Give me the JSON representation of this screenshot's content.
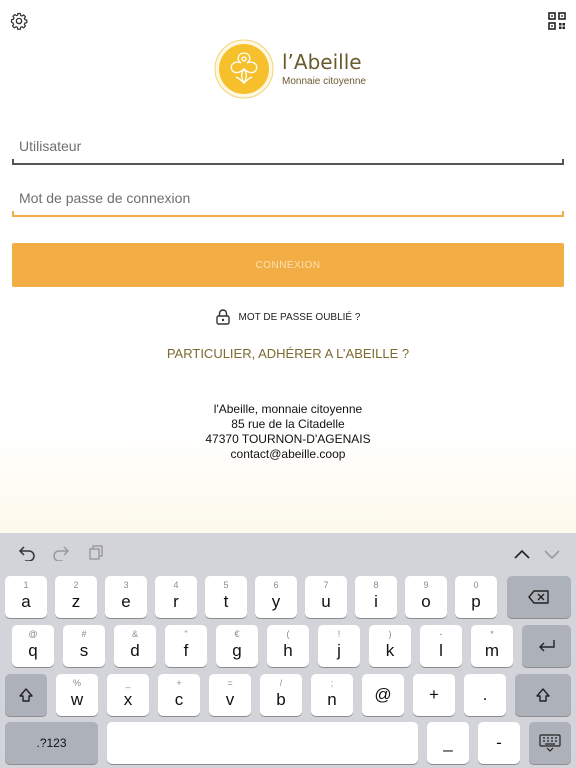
{
  "app": {
    "logo": {
      "title": "l’Abeille",
      "subtitle": "Monnaie citoyenne"
    },
    "icons": {
      "settings": "gear-icon",
      "scan": "qr-code-icon",
      "lock": "lock-icon"
    },
    "username": {
      "placeholder": "Utilisateur",
      "value": ""
    },
    "password": {
      "placeholder": "Mot de passe de connexion",
      "value": ""
    },
    "connect_label": "CONNEXION",
    "forgot_label": "MOT DE PASSE OUBLIÉ ?",
    "join_label": "PARTICULIER, ADHÉRER A L’ABEILLE ?",
    "address": {
      "line1": "l'Abeille, monnaie citoyenne",
      "line2": "85 rue de la Citadelle",
      "line3": "47370 TOURNON-D'AGENAIS",
      "email": "contact@abeille.coop"
    },
    "colors": {
      "accent": "#f2ad44",
      "brand": "#6b5a2e",
      "logo_yellow": "#f5c02c"
    }
  },
  "keyboard": {
    "toolbar": {
      "undo": "undo-icon",
      "redo": "redo-icon",
      "paste": "paste-icon",
      "prev": "chevron-up-icon",
      "next": "chevron-down-icon"
    },
    "row1": [
      {
        "main": "a",
        "alt": "1"
      },
      {
        "main": "z",
        "alt": "2"
      },
      {
        "main": "e",
        "alt": "3"
      },
      {
        "main": "r",
        "alt": "4"
      },
      {
        "main": "t",
        "alt": "5"
      },
      {
        "main": "y",
        "alt": "6"
      },
      {
        "main": "u",
        "alt": "7"
      },
      {
        "main": "i",
        "alt": "8"
      },
      {
        "main": "o",
        "alt": "9"
      },
      {
        "main": "p",
        "alt": "0"
      }
    ],
    "row2": [
      {
        "main": "q",
        "alt": "@"
      },
      {
        "main": "s",
        "alt": "#"
      },
      {
        "main": "d",
        "alt": "&"
      },
      {
        "main": "f",
        "alt": "\""
      },
      {
        "main": "g",
        "alt": "€"
      },
      {
        "main": "h",
        "alt": "("
      },
      {
        "main": "j",
        "alt": "!"
      },
      {
        "main": "k",
        "alt": ")"
      },
      {
        "main": "l",
        "alt": "-"
      },
      {
        "main": "m",
        "alt": "*"
      }
    ],
    "row3": [
      {
        "main": "w",
        "alt": "%"
      },
      {
        "main": "x",
        "alt": "_"
      },
      {
        "main": "c",
        "alt": "+"
      },
      {
        "main": "v",
        "alt": "="
      },
      {
        "main": "b",
        "alt": "/"
      },
      {
        "main": "n",
        "alt": ";"
      },
      {
        "main": "@",
        "alt": ""
      },
      {
        "main": "+",
        "alt": ""
      },
      {
        "main": ".",
        "alt": ""
      }
    ],
    "numbers_label": ".?123",
    "underscore_key": "_",
    "dash_key": "-"
  }
}
